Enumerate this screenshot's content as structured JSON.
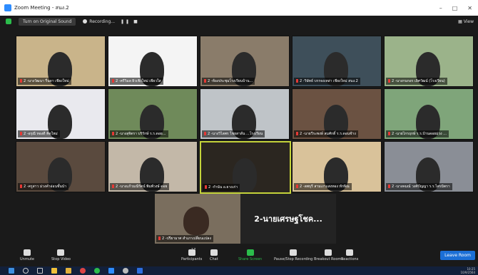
{
  "window": {
    "title": "Zoom Meeting - สนง.2"
  },
  "top_toolbar": {
    "sound_btn": "Turn on Original Sound",
    "recording": "Recording...",
    "view": "View"
  },
  "tiles": [
    {
      "label": "2 -นางวัฒนา รื่นดา เชียงใหม่",
      "bg": "#c9b48a"
    },
    {
      "label": "2 -ครีวิมล ผิวเชิงใหม่ เพียวใส",
      "bg": "#f4f4f4"
    },
    {
      "label": "2 -ห้องประชุมโรงเรียนบ้าน...",
      "bg": "#8a7c6a"
    },
    {
      "label": "2 -วิษัทธ์ บรรจงเหล่า เชียงใหม่ สนง.2",
      "bg": "#3e4f5a"
    },
    {
      "label": "2 -นางกนกอร เลิศวัฒน์ (โรงเรียน)",
      "bg": "#9bb38a"
    },
    {
      "label": "2 -อรุณี ทองดี คิดใหม่",
      "bg": "#e9e9ee"
    },
    {
      "label": "2 -นางสุจิตรา บริรักษ์ ร.ร.ดอย...",
      "bg": "#6f8a5a"
    },
    {
      "label": "2 -นางวิไลพร ไชยสาส์น ...โรงเรียน",
      "bg": "#bfc4c8"
    },
    {
      "label": "2 -นายวีระพงษ์ สมศักดิ์ ร.ร.ดอนช้าง",
      "bg": "#6b5242"
    },
    {
      "label": "2 -นายไกรฤกษ์ ร.ร.บ้านดอยม่วง ...",
      "bg": "#7fa57a"
    },
    {
      "label": "2 -ครูสาว ม่วงคำอ่อนชั้นนำ",
      "bg": "#5a4a3e"
    },
    {
      "label": "2 -นางแก้วมณีรัตน์ พิมพ์วงษ์ ดอย",
      "bg": "#c3b8a8"
    },
    {
      "label": "2 -กำนัน อ.ยางเก่า",
      "bg": "#2b2620"
    },
    {
      "label": "2 -ลพบุรี สามเงาแสงทอง ทักษิณ",
      "bg": "#d9c29a"
    },
    {
      "label": "2 -นางคมณ์ วงศ์ปัญญา ร.ร.ไตรมิตรา",
      "bg": "#8a8e96"
    }
  ],
  "bottom_tile": {
    "label": "2 -ปรียามาศ สำเภาเปลี่ยนแปลง"
  },
  "name_tile": {
    "name": "2-นายเศรษฐโชค..."
  },
  "controls": [
    {
      "label": "Unmute"
    },
    {
      "label": "Stop Video"
    },
    {
      "label": "Participants",
      "count": "17"
    },
    {
      "label": "Chat"
    },
    {
      "label": "Share Screen"
    },
    {
      "label": "Pause/Stop Recording"
    },
    {
      "label": "Breakout Rooms"
    },
    {
      "label": "Reactions"
    }
  ],
  "leave_btn": "Leave Room",
  "clock": {
    "time": "10:25",
    "date": "10/9/2564"
  }
}
